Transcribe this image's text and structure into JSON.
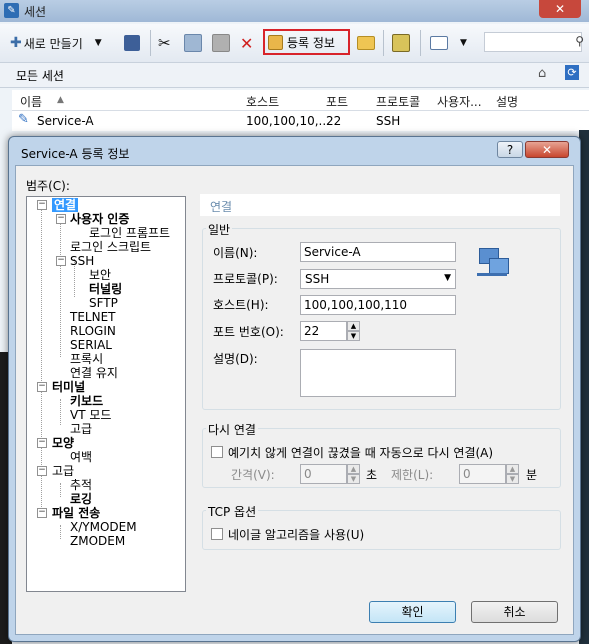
{
  "app": {
    "title": "세션"
  },
  "toolbar": {
    "new_label": "새로 만들기",
    "register_info_label": "등록 정보"
  },
  "sessions": {
    "header": "모든 세션",
    "columns": [
      "이름",
      "호스트",
      "포트",
      "프로토콜",
      "사용자...",
      "설명"
    ],
    "rows": [
      {
        "name": "Service-A",
        "host": "100,100,10,...",
        "port": "22",
        "protocol": "SSH",
        "user": "",
        "desc": ""
      }
    ]
  },
  "dialog": {
    "title": "Service-A 등록 정보",
    "help": "?",
    "close": "✕",
    "category_label": "범주(C):",
    "tree": {
      "connection": "연결",
      "user_auth": "사용자 인증",
      "login_prompt": "로그인 프롬프트",
      "login_script": "로그인 스크립트",
      "ssh": "SSH",
      "security": "보안",
      "tunneling": "터널링",
      "sftp": "SFTP",
      "telnet": "TELNET",
      "rlogin": "RLOGIN",
      "serial": "SERIAL",
      "proxy": "프록시",
      "keep_alive": "연결 유지",
      "terminal": "터미널",
      "keyboard": "키보드",
      "vt_mode": "VT 모드",
      "advanced": "고급",
      "appearance": "모양",
      "margin": "여백",
      "advanced2": "고급",
      "trace": "추적",
      "logging": "로깅",
      "file_transfer": "파일 전송",
      "xymodem": "X/YMODEM",
      "zmodem": "ZMODEM"
    },
    "section_title": "연결",
    "general": {
      "label": "일반",
      "name_label": "이름(N):",
      "name_value": "Service-A",
      "protocol_label": "프로토콜(P):",
      "protocol_value": "SSH",
      "host_label": "호스트(H):",
      "host_value": "100,100,100,110",
      "port_label": "포트 번호(O):",
      "port_value": "22",
      "desc_label": "설명(D):",
      "desc_value": ""
    },
    "reconnect": {
      "label": "다시 연결",
      "checkbox_label": "예기치 않게 연결이 끊겼을 때 자동으로 다시 연결(A)",
      "interval_label": "간격(V):",
      "interval_value": "0",
      "interval_unit": "초",
      "limit_label": "제한(L):",
      "limit_value": "0",
      "limit_unit": "분"
    },
    "tcp": {
      "label": "TCP 옵션",
      "nagle_label": "네이글 알고리즘을 사용(U)"
    },
    "ok": "확인",
    "cancel": "취소"
  }
}
